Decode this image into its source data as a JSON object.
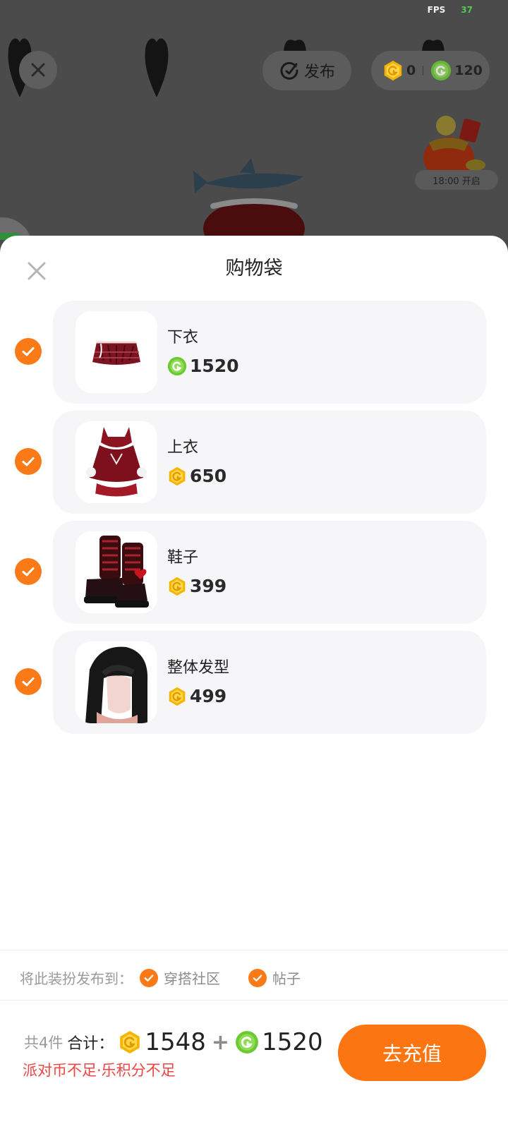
{
  "status": {
    "fps_label": "FPS",
    "fps_value": "37"
  },
  "scene": {
    "publish_label": "发布",
    "party_coins": "0",
    "le_points": "120",
    "event_time": "18:00 开启"
  },
  "sheet": {
    "title": "购物袋",
    "items": [
      {
        "name": "下衣",
        "price": "1520",
        "currency": "le-points",
        "checked": true
      },
      {
        "name": "上衣",
        "price": "650",
        "currency": "party-coin",
        "checked": true
      },
      {
        "name": "鞋子",
        "price": "399",
        "currency": "party-coin",
        "checked": true
      },
      {
        "name": "整体发型",
        "price": "499",
        "currency": "party-coin",
        "checked": true
      }
    ],
    "publish_to_label": "将此装扮发布到：",
    "publish_options": [
      "穿搭社区",
      "帖子"
    ]
  },
  "footer": {
    "count_label": "共4件",
    "total_label": "合计：",
    "party_coin_total": "1548",
    "plus": "+",
    "le_points_total": "1520",
    "warning": "派对币不足·乐积分不足",
    "recharge_label": "去充值"
  },
  "colors": {
    "accent_orange": "#fb7a18",
    "warning_red": "#f04444",
    "gold_coin": "#f4c21a",
    "green_coin": "#6cc933"
  }
}
